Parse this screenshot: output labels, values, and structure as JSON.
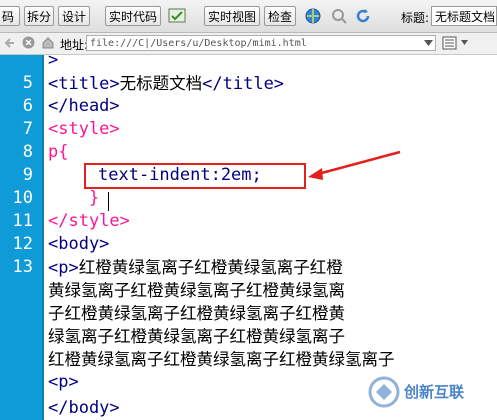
{
  "toolbar": {
    "code_view": "码",
    "split_view": "拆分",
    "design_view": "设计",
    "live_code": "实时代码",
    "live_view": "实时视图",
    "inspect": "检查",
    "title_label": "标题:",
    "title_value": "无标题文档"
  },
  "address": {
    "label": "地址:",
    "value": "file:///C|/Users/u/Desktop/mimi.html"
  },
  "editor": {
    "line_numbers": [
      "5",
      "6",
      "7",
      "8",
      "9",
      "10",
      "11",
      "12",
      "13"
    ],
    "lines": {
      "l4_partial": ">",
      "l5_open": "<title>",
      "l5_text": "无标题文档",
      "l5_close": "</title>",
      "l6": "</head>",
      "l7": "<style>",
      "l8": "p{",
      "l9": "text-indent:2em;",
      "l10": "}",
      "l11": "</style>",
      "l12": "<body>",
      "l13_tag": "<p>",
      "l13_text": "红橙黄绿氢离子红橙黄绿氢离子红橙",
      "wrap1": "黄绿氢离子红橙黄绿氢离子红橙黄绿氢离",
      "wrap2": "子红橙黄绿氢离子红橙黄绿氢离子红橙黄",
      "wrap3": "绿氢离子红橙黄绿氢离子红橙黄绿氢离子",
      "wrap4": "红橙黄绿氢离子红橙黄绿氢离子红橙黄绿氢离子",
      "l14": "<p>",
      "l15_partial": "</body>"
    }
  },
  "watermark": {
    "brand": "创新互联"
  },
  "colors": {
    "gutter": "#0f9bd7",
    "tag": "#000080",
    "style_tag": "#ff1493",
    "highlight": "#e2201c"
  }
}
